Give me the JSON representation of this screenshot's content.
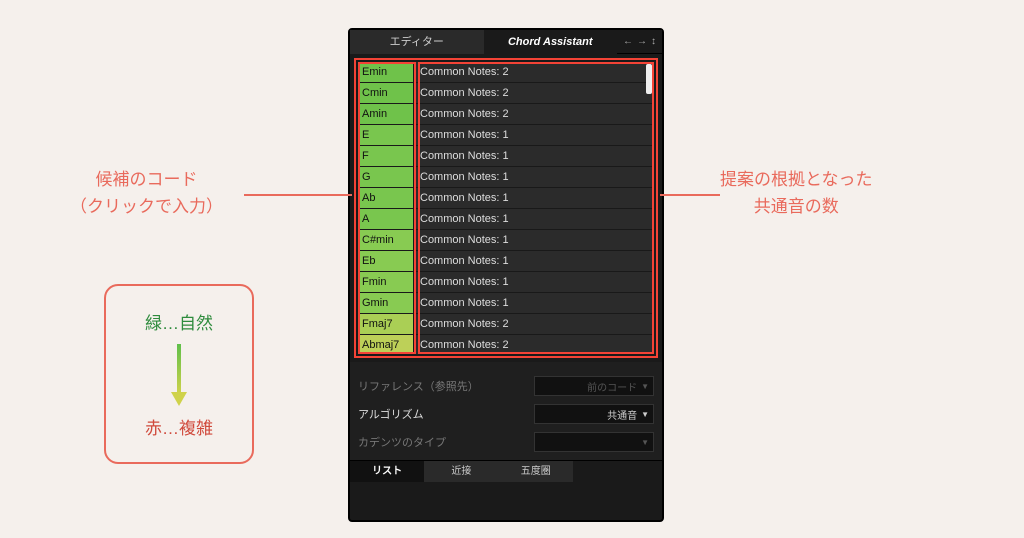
{
  "topTabs": {
    "editor": "エディター",
    "assistant": "Chord Assistant"
  },
  "chords": [
    {
      "name": "Emin",
      "desc": "Common Notes: 2",
      "color": "#6fc24a"
    },
    {
      "name": "Cmin",
      "desc": "Common Notes: 2",
      "color": "#6fc24a"
    },
    {
      "name": "Amin",
      "desc": "Common Notes: 2",
      "color": "#6fc24a"
    },
    {
      "name": "E",
      "desc": "Common Notes: 1",
      "color": "#79c64e"
    },
    {
      "name": "F",
      "desc": "Common Notes: 1",
      "color": "#79c64e"
    },
    {
      "name": "G",
      "desc": "Common Notes: 1",
      "color": "#79c64e"
    },
    {
      "name": "Ab",
      "desc": "Common Notes: 1",
      "color": "#79c64e"
    },
    {
      "name": "A",
      "desc": "Common Notes: 1",
      "color": "#79c64e"
    },
    {
      "name": "C#min",
      "desc": "Common Notes: 1",
      "color": "#88cb52"
    },
    {
      "name": "Eb",
      "desc": "Common Notes: 1",
      "color": "#88cb52"
    },
    {
      "name": "Fmin",
      "desc": "Common Notes: 1",
      "color": "#88cb52"
    },
    {
      "name": "Gmin",
      "desc": "Common Notes: 1",
      "color": "#88cb52"
    },
    {
      "name": "Fmaj7",
      "desc": "Common Notes: 2",
      "color": "#aacf55"
    },
    {
      "name": "Abmaj7",
      "desc": "Common Notes: 2",
      "color": "#bdd058"
    }
  ],
  "controls": {
    "reference": {
      "label": "リファレンス（参照先）",
      "value": "前のコード"
    },
    "algorithm": {
      "label": "アルゴリズム",
      "value": "共通音"
    },
    "cadence": {
      "label": "カデンツのタイプ",
      "value": ""
    }
  },
  "bottomTabs": {
    "list": "リスト",
    "proximity": "近接",
    "circle": "五度圏"
  },
  "annotations": {
    "leftLine1": "候補のコード",
    "leftLine2": "（クリックで入力）",
    "rightLine1": "提案の根拠となった",
    "rightLine2": "共通音の数",
    "legendGreen": "緑…自然",
    "legendRed": "赤…複雑"
  }
}
